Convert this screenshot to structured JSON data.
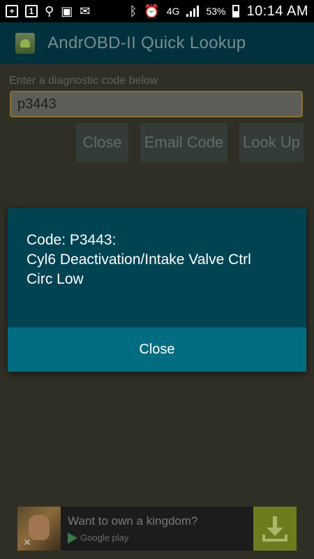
{
  "status_bar": {
    "battery": "53%",
    "time": "10:14 AM",
    "network": "4G"
  },
  "app": {
    "title": "AndrOBD-II Quick Lookup"
  },
  "form": {
    "hint": "Enter a diagnostic code below",
    "code_value": "p3443",
    "buttons": {
      "close": "Close",
      "email": "Email Code",
      "lookup": "Look Up"
    }
  },
  "dialog": {
    "message_lines": [
      "Code: P3443:",
      "Cyl6 Deactivation/Intake Valve Ctrl",
      "Circ Low"
    ],
    "close_label": "Close"
  },
  "ad": {
    "headline": "Want to own a kingdom?",
    "store": "Google play",
    "close_glyph": "✕"
  },
  "colors": {
    "dialog_bg": "#004454",
    "dialog_button_bg": "#006c80",
    "action_bar_bg": "#00323d",
    "input_border": "#8a7133",
    "ad_download_bg": "#6b7d1e"
  }
}
